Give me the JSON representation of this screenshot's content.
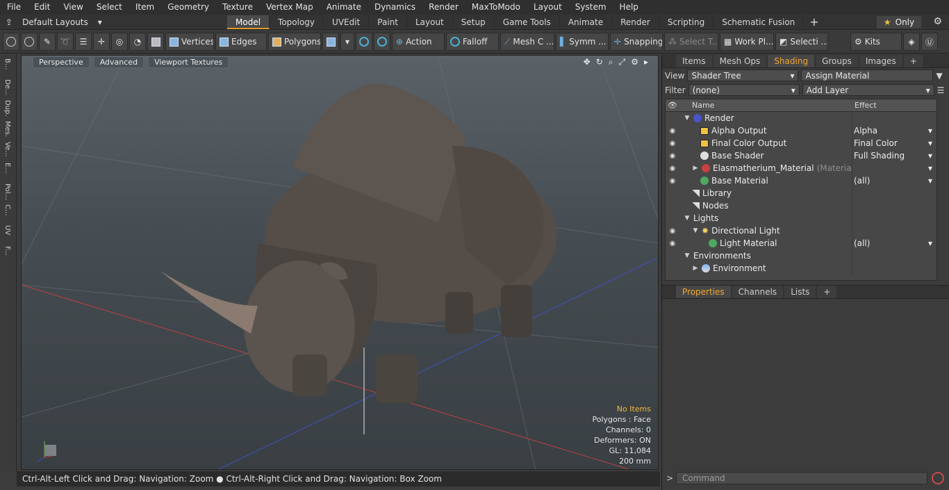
{
  "menu": [
    "File",
    "Edit",
    "View",
    "Select",
    "Item",
    "Geometry",
    "Texture",
    "Vertex Map",
    "Animate",
    "Dynamics",
    "Render",
    "MaxToModo",
    "Layout",
    "System",
    "Help"
  ],
  "layout_label": "Default Layouts",
  "mode_tabs": [
    "Model",
    "Topology",
    "UVEdit",
    "Paint",
    "Layout",
    "Setup",
    "Game Tools",
    "Animate",
    "Render",
    "Scripting",
    "Schematic Fusion"
  ],
  "only_label": "Only",
  "toolbar": {
    "vertices": "Vertices",
    "edges": "Edges",
    "polygons": "Polygons",
    "action": "Action",
    "falloff": "Falloff",
    "meshc": "Mesh C ...",
    "symm": "Symm ...",
    "snapping": "Snapping",
    "selectt": "Select T...",
    "workpl": "Work Pl...",
    "selecti": "Selecti ...",
    "kits": "Kits"
  },
  "left_strip": [
    "B...",
    "De...",
    "Dup...",
    "Mes...",
    "Ve...",
    "E...",
    "Pol...",
    "C...",
    "UV",
    "F..."
  ],
  "viewport": {
    "perspective": "Perspective",
    "advanced": "Advanced",
    "textures": "Viewport Textures"
  },
  "vp_info": {
    "items": "No Items",
    "polygons": "Polygons : Face",
    "channels": "Channels: 0",
    "deformers": "Deformers: ON",
    "gl": "GL: 11,084",
    "scale": "200 mm"
  },
  "status": "Ctrl-Alt-Left Click and Drag: Navigation: Zoom ● Ctrl-Alt-Right Click and Drag: Navigation: Box Zoom",
  "panel_tabs": [
    "Items",
    "Mesh Ops",
    "Shading",
    "Groups",
    "Images"
  ],
  "view_label": "View",
  "view_value": "Shader Tree",
  "assign_material": "Assign Material",
  "filter_label": "Filter",
  "filter_value": "(none)",
  "add_layer": "Add Layer",
  "tree_headers": {
    "name": "Name",
    "effect": "Effect"
  },
  "tree": [
    {
      "name": "Render",
      "effect": "",
      "icon": "ball-blue"
    },
    {
      "name": "Alpha Output",
      "effect": "Alpha",
      "icon": "tag"
    },
    {
      "name": "Final Color Output",
      "effect": "Final Color",
      "icon": "tag"
    },
    {
      "name": "Base Shader",
      "effect": "Full Shading",
      "icon": "ball-white"
    },
    {
      "name": "Elasmatherium_Material",
      "suffix": "(Material)",
      "effect": "",
      "icon": "ball-red"
    },
    {
      "name": "Base Material",
      "effect": "(all)",
      "icon": "ball-green"
    },
    {
      "name": "Library",
      "effect": "",
      "icon": "folder"
    },
    {
      "name": "Nodes",
      "effect": "",
      "icon": "folder"
    },
    {
      "name": "Lights",
      "effect": "",
      "icon": "none"
    },
    {
      "name": "Directional Light",
      "effect": "",
      "icon": "light"
    },
    {
      "name": "Light Material",
      "effect": "(all)",
      "icon": "ball-green"
    },
    {
      "name": "Environments",
      "effect": "",
      "icon": "none"
    },
    {
      "name": "Environment",
      "effect": "",
      "icon": "ball-env"
    }
  ],
  "prop_tabs": [
    "Properties",
    "Channels",
    "Lists"
  ],
  "command_placeholder": "Command"
}
